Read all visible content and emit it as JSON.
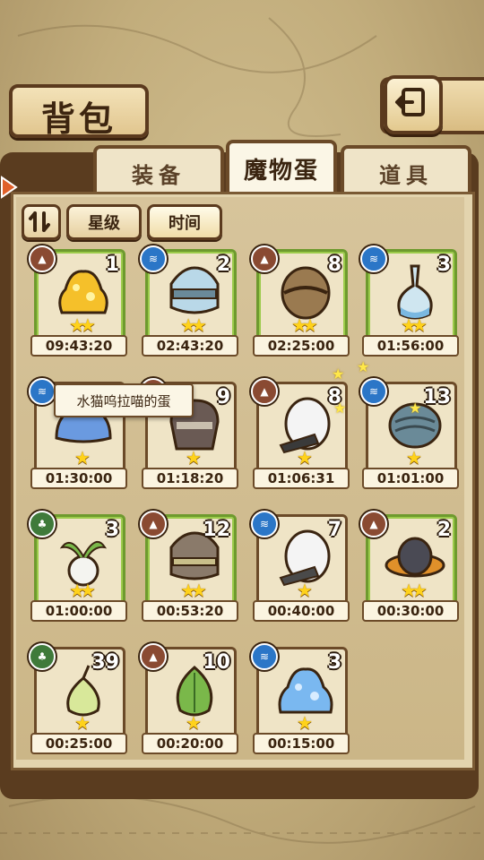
{
  "header": {
    "title": "背包",
    "back_icon": "return-arrow-icon"
  },
  "tabs": [
    {
      "label": "装备",
      "active": false
    },
    {
      "label": "魔物蛋",
      "active": true
    },
    {
      "label": "道具",
      "active": false
    }
  ],
  "sort": {
    "toggle_icon": "sort-toggle-icon",
    "star_label": "星级",
    "time_label": "时间",
    "active": "时间"
  },
  "tooltip": "水猫呜拉喵的蛋",
  "colors": {
    "earth": "#8a4a32",
    "water": "#2b76c7",
    "nature": "#3f7a3a"
  },
  "eggs": [
    {
      "element": "earth",
      "count": "1",
      "stars": 2,
      "time": "09:43:20",
      "name": "golden-slime-egg"
    },
    {
      "element": "water",
      "count": "2",
      "stars": 2,
      "time": "02:43:20",
      "name": "ice-golem-egg"
    },
    {
      "element": "earth",
      "count": "8",
      "stars": 2,
      "time": "02:25:00",
      "name": "wooden-barrel-egg"
    },
    {
      "element": "water",
      "count": "3",
      "stars": 2,
      "time": "01:56:00",
      "name": "flask-egg"
    },
    {
      "element": "water",
      "count": "",
      "stars": 1,
      "time": "01:30:00",
      "name": "water-cat-egg"
    },
    {
      "element": "earth",
      "count": "9",
      "stars": 1,
      "time": "01:18:20",
      "name": "iron-helmet-egg"
    },
    {
      "element": "earth",
      "count": "8",
      "stars": 1,
      "time": "01:06:31",
      "name": "striped-tail-egg"
    },
    {
      "element": "water",
      "count": "13",
      "stars": 1,
      "time": "01:01:00",
      "name": "shell-egg"
    },
    {
      "element": "nature",
      "count": "3",
      "stars": 2,
      "time": "01:00:00",
      "name": "radish-egg"
    },
    {
      "element": "earth",
      "count": "12",
      "stars": 2,
      "time": "00:53:20",
      "name": "stone-golem-egg"
    },
    {
      "element": "water",
      "count": "7",
      "stars": 1,
      "time": "00:40:00",
      "name": "white-striped-egg"
    },
    {
      "element": "earth",
      "count": "2",
      "stars": 2,
      "time": "00:30:00",
      "name": "hat-egg"
    },
    {
      "element": "nature",
      "count": "39",
      "stars": 1,
      "time": "00:25:00",
      "name": "sprout-bulb-egg"
    },
    {
      "element": "earth",
      "count": "10",
      "stars": 1,
      "time": "00:20:00",
      "name": "leaf-egg"
    },
    {
      "element": "water",
      "count": "3",
      "stars": 1,
      "time": "00:15:00",
      "name": "blue-slime-egg"
    }
  ]
}
